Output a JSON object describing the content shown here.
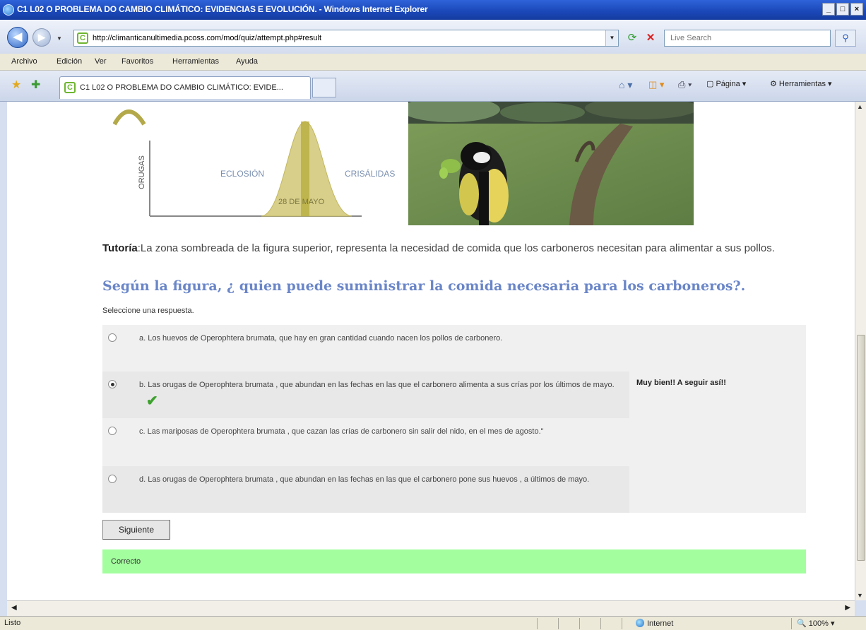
{
  "window": {
    "title": "C1 L02 O PROBLEMA DO CAMBIO CLIMÁTICO: EVIDENCIAS E EVOLUCIÓN. - Windows Internet Explorer",
    "controls": [
      "_",
      "□",
      "×"
    ]
  },
  "address": {
    "url": "http://climanticanultimedia.pcoss.com/mod/quiz/attempt.php#result",
    "search_placeholder": "Live Search"
  },
  "menu": {
    "items": [
      "Archivo",
      "Edición",
      "Ver",
      "Favoritos",
      "Herramientas",
      "Ayuda"
    ]
  },
  "tab": {
    "title": "C1 L02 O PROBLEMA DO CAMBIO CLIMÁTICO: EVIDE..."
  },
  "commands": {
    "page": "Página",
    "tools": "Herramientas"
  },
  "figure": {
    "ylabel": "ORUGAS",
    "left_label": "ECLOSIÓN",
    "right_label": "CRISÁLIDAS",
    "peak_label": "28 DE MAYO"
  },
  "tutorial": {
    "label": "Tutoría",
    "text": ":La zona sombreada de la figura superior, representa la necesidad de comida que los carboneros necesitan para alimentar a sus pollos."
  },
  "question": "Según la figura, ¿ quien puede suministrar la comida necesaria para los carboneros?.",
  "prompt": "Seleccione una respuesta.",
  "answers": [
    {
      "text": "a. Los huevos de Operophtera brumata, que hay en gran cantidad cuando nacen los pollos de carbonero.",
      "checked": false,
      "feedback": ""
    },
    {
      "text": "b. Las orugas de Operophtera brumata , que abundan en las fechas en las que el carbonero alimenta a sus crías por los últimos de mayo.",
      "checked": true,
      "feedback": "Muy bien!! A seguir así!!"
    },
    {
      "text": "c. Las mariposas de Operophtera brumata , que cazan las crías de carbonero sin salir del nido, en el mes de agosto.\"",
      "checked": false,
      "feedback": ""
    },
    {
      "text": "d. Las orugas de Operophtera brumata , que abundan en las fechas en las que el carbonero pone sus huevos , a últimos de mayo.",
      "checked": false,
      "feedback": ""
    }
  ],
  "next_button": "Siguiente",
  "result": "Correcto",
  "status": {
    "text": "Listo",
    "zone": "Internet",
    "zoom": "100%"
  },
  "colors": {
    "question": "#6a86c8",
    "correct_bg": "#a3ff9e",
    "curve_fill": "#d8cf8a"
  }
}
